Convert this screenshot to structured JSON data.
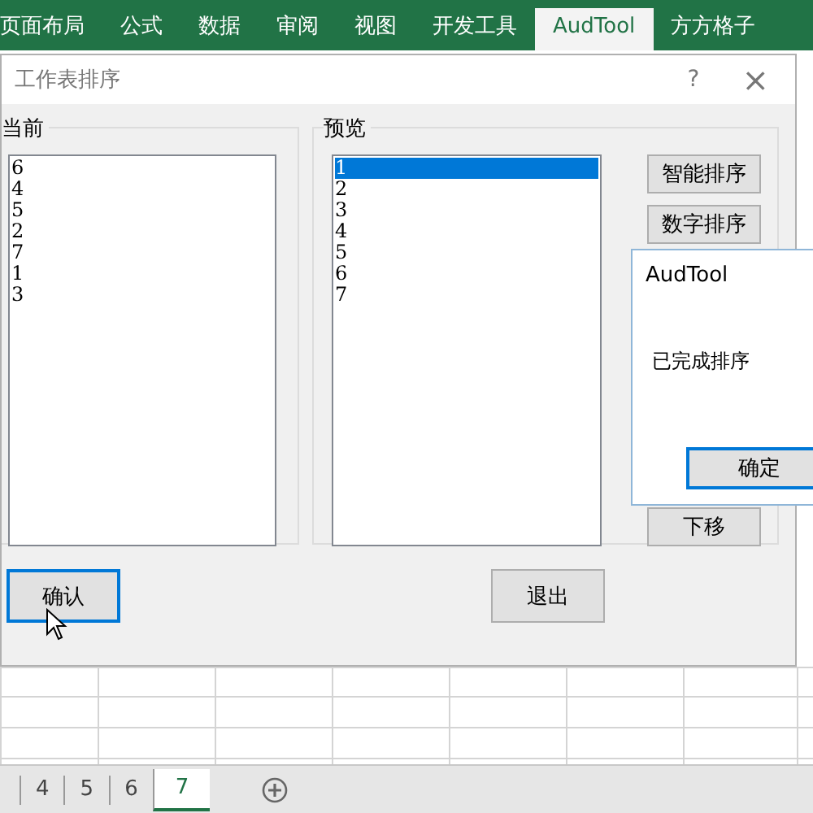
{
  "ribbon_tabs": [
    {
      "label": "页面布局",
      "selected": false
    },
    {
      "label": "公式",
      "selected": false
    },
    {
      "label": "数据",
      "selected": false
    },
    {
      "label": "审阅",
      "selected": false
    },
    {
      "label": "视图",
      "selected": false
    },
    {
      "label": "开发工具",
      "selected": false
    },
    {
      "label": "AudTool",
      "selected": true
    },
    {
      "label": "方方格子",
      "selected": false
    }
  ],
  "dialog": {
    "title": "工作表排序",
    "help": "?",
    "close": "×",
    "current": {
      "label": "当前",
      "items": [
        {
          "text": "6",
          "selected": false
        },
        {
          "text": "4",
          "selected": false
        },
        {
          "text": "5",
          "selected": false
        },
        {
          "text": "2",
          "selected": false
        },
        {
          "text": "7",
          "selected": false
        },
        {
          "text": "1",
          "selected": false
        },
        {
          "text": "3",
          "selected": false
        }
      ]
    },
    "preview": {
      "label": "预览",
      "items": [
        {
          "text": "1",
          "selected": true
        },
        {
          "text": "2",
          "selected": false
        },
        {
          "text": "3",
          "selected": false
        },
        {
          "text": "4",
          "selected": false
        },
        {
          "text": "5",
          "selected": false
        },
        {
          "text": "6",
          "selected": false
        },
        {
          "text": "7",
          "selected": false
        }
      ]
    },
    "side_buttons": [
      "智能排序",
      "数字排序"
    ],
    "bottom_side_button": "下移",
    "confirm": {
      "label": "确认",
      "focused": true
    },
    "exit": "退出"
  },
  "message_box": {
    "title": "AudTool",
    "message": "已完成排序",
    "ok": "确定"
  },
  "sheet_tabs": [
    {
      "label": "4",
      "selected": false
    },
    {
      "label": "5",
      "selected": false
    },
    {
      "label": "6",
      "selected": false
    },
    {
      "label": "7",
      "selected": true
    }
  ]
}
